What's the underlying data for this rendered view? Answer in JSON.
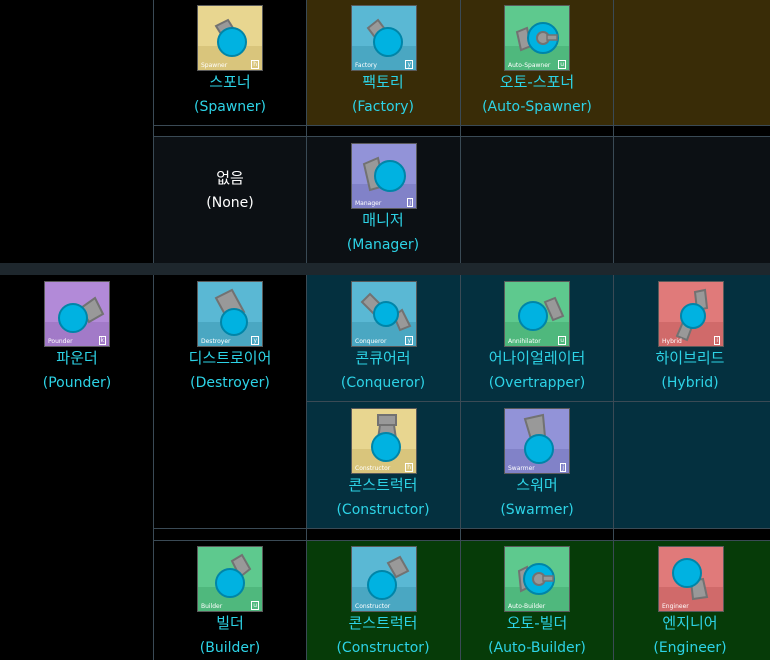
{
  "colors": {
    "spawner_row_bg": "#392c07",
    "manager_row_bg": "#0c1014",
    "pounder_group_bg": "#04303f",
    "builder_row_bg": "#063b08",
    "divider": "#1e272d",
    "text_accent": "#2dd3e6",
    "card_yellow": "#e8d690",
    "card_blue": "#5ab8d4",
    "card_green": "#5ec98e",
    "card_purple": "#b28ad8",
    "card_red": "#e07a7a",
    "card_indigo": "#9293d8",
    "barrel": "#999999",
    "body": "#00b2e1"
  },
  "tanks": {
    "spawner": {
      "card_label": "Spawner",
      "key": "h",
      "name_ko": "스포너",
      "name_en": "(Spawner)"
    },
    "factory": {
      "card_label": "Factory",
      "key": "y",
      "name_ko": "팩토리",
      "name_en": "(Factory)"
    },
    "auto_spawner": {
      "card_label": "Auto-Spawner",
      "key": "u",
      "name_ko": "오토-스포너",
      "name_en": "(Auto-Spawner)"
    },
    "none": {
      "name_ko": "없음",
      "name_en": "(None)"
    },
    "manager": {
      "card_label": "Manager",
      "key": "j",
      "name_ko": "매니저",
      "name_en": "(Manager)"
    },
    "pounder": {
      "card_label": "Pounder",
      "key": "k",
      "name_ko": "파운더",
      "name_en": "(Pounder)"
    },
    "destroyer": {
      "card_label": "Destroyer",
      "key": "y",
      "name_ko": "디스트로이어",
      "name_en": "(Destroyer)"
    },
    "conqueror": {
      "card_label": "Conqueror",
      "key": "y",
      "name_ko": "콘큐어러",
      "name_en": "(Conqueror)"
    },
    "annihilator": {
      "card_label": "Annihilator",
      "key": "u",
      "name_ko": "어나이얼레이터",
      "name_en": "(Overtrapper)"
    },
    "hybrid": {
      "card_label": "Hybrid",
      "key": "i",
      "name_ko": "하이브리드",
      "name_en": "(Hybrid)"
    },
    "constructor_a": {
      "card_label": "Constructor",
      "key": "h",
      "name_ko": "콘스트럭터",
      "name_en": "(Constructor)"
    },
    "swarmer": {
      "card_label": "Swarmer",
      "key": "j",
      "name_ko": "스워머",
      "name_en": "(Swarmer)"
    },
    "builder": {
      "card_label": "Builder",
      "key": "u",
      "name_ko": "빌더",
      "name_en": "(Builder)"
    },
    "constructor_b": {
      "card_label": "Constructor",
      "key": "",
      "name_ko": "콘스트럭터",
      "name_en": "(Constructor)"
    },
    "auto_builder": {
      "card_label": "Auto-Builder",
      "key": "",
      "name_ko": "오토-빌더",
      "name_en": "(Auto-Builder)"
    },
    "engineer": {
      "card_label": "Engineer",
      "key": "",
      "name_ko": "엔지니어",
      "name_en": "(Engineer)"
    }
  }
}
